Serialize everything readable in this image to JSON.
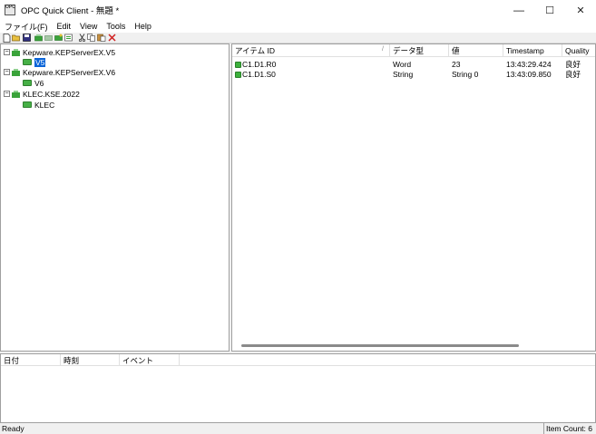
{
  "window": {
    "icon_text": "OPC",
    "title": "OPC Quick Client - 無題 *",
    "minimize": "—",
    "maximize": "☐",
    "close": "✕"
  },
  "menu": [
    "ファイル(F)",
    "Edit",
    "View",
    "Tools",
    "Help"
  ],
  "toolbar_icons": [
    "new-icon",
    "open-icon",
    "save-icon",
    "new-server-icon",
    "new-group-icon",
    "new-item-icon",
    "properties-icon",
    "cut-icon",
    "copy-icon",
    "paste-icon",
    "delete-icon"
  ],
  "tree": {
    "servers": [
      {
        "label": "Kepware.KEPServerEX.V5",
        "group": "V5",
        "selected": true
      },
      {
        "label": "Kepware.KEPServerEX.V6",
        "group": "V6",
        "selected": false
      },
      {
        "label": "KLEC.KSE.2022",
        "group": "KLEC",
        "selected": false
      }
    ]
  },
  "list": {
    "columns": [
      "アイテム ID",
      "データ型",
      "値",
      "Timestamp",
      "Quality"
    ],
    "sort_indicator": "/",
    "rows": [
      {
        "id": "C1.D1.R0",
        "type": "Word",
        "value": "23",
        "timestamp": "13:43:29.424",
        "quality": "良好"
      },
      {
        "id": "C1.D1.S0",
        "type": "String",
        "value": "String 0",
        "timestamp": "13:43:09.850",
        "quality": "良好"
      }
    ]
  },
  "log": {
    "columns": [
      "日付",
      "時刻",
      "イベント"
    ]
  },
  "status": {
    "left": "Ready",
    "right": "Item Count: 6"
  }
}
